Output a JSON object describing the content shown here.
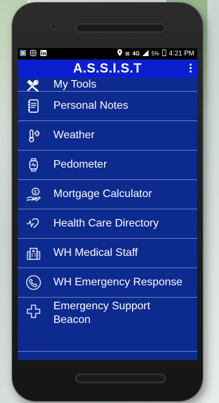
{
  "status": {
    "left_icons": [
      "app-notification-icon",
      "instagram-icon",
      "linkedin-icon"
    ],
    "network": "4G",
    "battery": "5%",
    "time": "4:21 PM"
  },
  "app": {
    "title": "A.S.S.I.S.T"
  },
  "menu": {
    "items": [
      {
        "label": "My Tools",
        "icon": "tools-icon"
      },
      {
        "label": "Personal Notes",
        "icon": "notes-icon"
      },
      {
        "label": "Weather",
        "icon": "weather-icon"
      },
      {
        "label": "Pedometer",
        "icon": "watch-icon"
      },
      {
        "label": "Mortgage Calculator",
        "icon": "mortgage-icon"
      },
      {
        "label": "Health Care Directory",
        "icon": "heartbeat-icon"
      },
      {
        "label": "WH Medical Staff",
        "icon": "hospital-icon"
      },
      {
        "label": "WH Emergency Response",
        "icon": "phone-icon"
      },
      {
        "label": "Emergency Support Beacon",
        "icon": "medical-cross-icon"
      }
    ]
  },
  "colors": {
    "screen_bg": "#0d2a8e",
    "appbar_bg": "#0b1fcf",
    "divider": "#6a7fc8"
  }
}
